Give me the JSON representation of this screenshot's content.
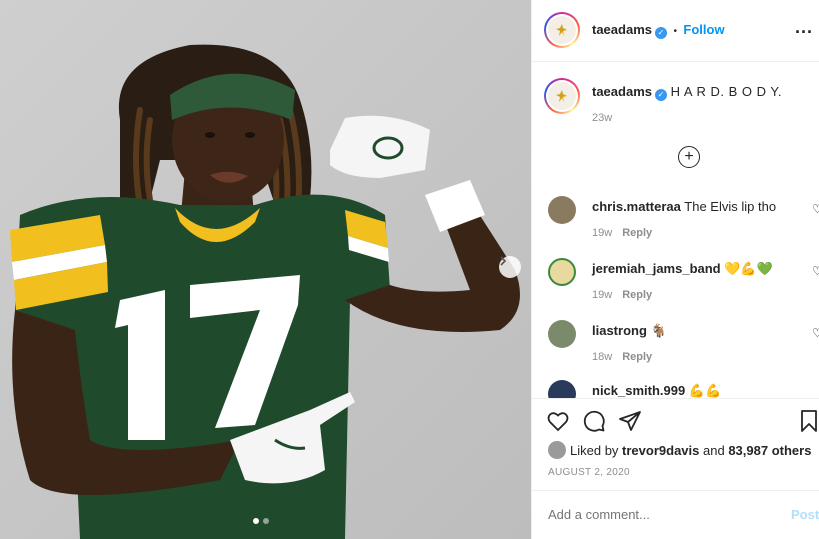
{
  "post": {
    "username": "taeadams",
    "follow_label": "Follow",
    "separator": "•",
    "more_label": "...",
    "caption": "H A R D. B O D Y.",
    "caption_time": "23w",
    "jersey_number": "17",
    "carousel": {
      "total": 2,
      "current": 1
    }
  },
  "comments": [
    {
      "username": "chris.matteraa",
      "text": "The Elvis lip tho",
      "time": "19w",
      "reply_label": "Reply"
    },
    {
      "username": "jeremiah_jams_band",
      "text": "💛💪💚",
      "time": "19w",
      "reply_label": "Reply"
    },
    {
      "username": "liastrong",
      "text": "🐐",
      "time": "18w",
      "reply_label": "Reply"
    },
    {
      "username": "nick_smith.999",
      "text": "💪💪",
      "time": "",
      "reply_label": ""
    }
  ],
  "engagement": {
    "liked_prefix": "Liked by",
    "liked_user": "trevor9davis",
    "liked_and": "and",
    "likes_count": "83,987 others",
    "date": "AUGUST 2, 2020",
    "comment_placeholder": "Add a comment...",
    "post_label": "Post"
  },
  "colors": {
    "jersey_green": "#1f4a2c",
    "jersey_gold": "#f2c01e",
    "link_blue": "#0095f6",
    "verified_blue": "#3897f0"
  },
  "icons": [
    "heart-icon",
    "comment-icon",
    "share-icon",
    "bookmark-icon",
    "add-circle-icon",
    "verified-badge-icon",
    "chevron-right-icon",
    "more-options-icon"
  ]
}
